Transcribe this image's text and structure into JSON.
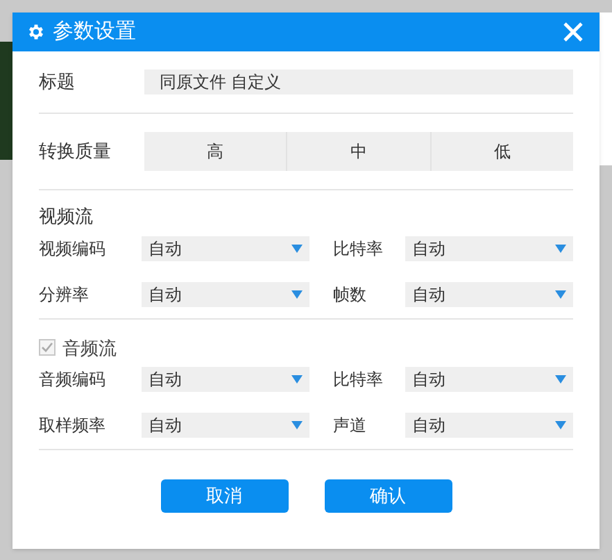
{
  "window": {
    "title": "参数设置"
  },
  "title_field": {
    "label": "标题",
    "value": "同原文件 自定义"
  },
  "quality": {
    "label": "转换质量",
    "options": [
      {
        "label": "高",
        "selected": false
      },
      {
        "label": "中",
        "selected": false
      },
      {
        "label": "低",
        "selected": false
      }
    ]
  },
  "video": {
    "heading": "视频流",
    "fields": [
      {
        "label": "视频编码",
        "value": "自动"
      },
      {
        "label": "比特率",
        "value": "自动"
      },
      {
        "label": "分辨率",
        "value": "自动"
      },
      {
        "label": "帧数",
        "value": "自动"
      }
    ]
  },
  "audio": {
    "heading": "音频流",
    "checked": true,
    "disabled": true,
    "fields": [
      {
        "label": "音频编码",
        "value": "自动"
      },
      {
        "label": "比特率",
        "value": "自动"
      },
      {
        "label": "取样频率",
        "value": "自动"
      },
      {
        "label": "声道",
        "value": "自动"
      }
    ]
  },
  "buttons": [
    "取消",
    "确认"
  ]
}
